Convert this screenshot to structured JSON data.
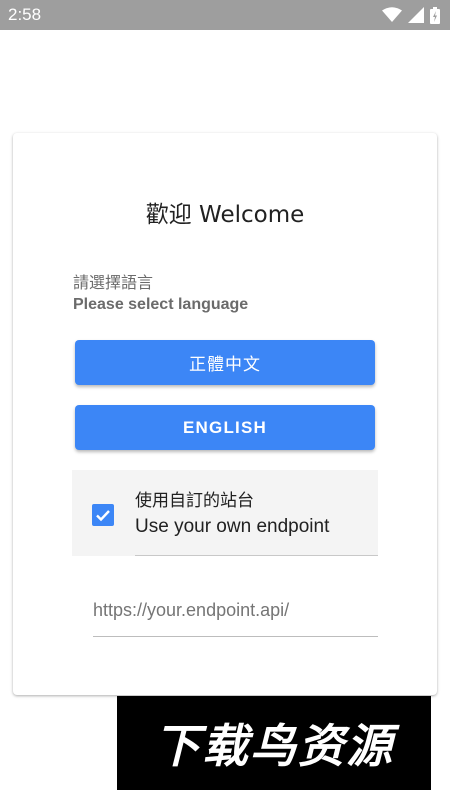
{
  "status_bar": {
    "time": "2:58",
    "icons": [
      "wifi-icon",
      "signal-icon",
      "battery-icon"
    ]
  },
  "welcome": {
    "title": "歡迎 Welcome",
    "prompt_zh": "請選擇語言",
    "prompt_en": "Please select language",
    "btn_traditional_chinese": "正體中文",
    "btn_english": "ENGLISH"
  },
  "endpoint": {
    "checked": true,
    "label_zh": "使用自訂的站台",
    "label_en": "Use your own endpoint",
    "placeholder": "https://your.endpoint.api/"
  },
  "watermark": {
    "text": "下载鸟资源"
  },
  "colors": {
    "accent": "#3c86f6",
    "status_bar": "#9e9e9e",
    "row_background": "#f4f4f4"
  }
}
